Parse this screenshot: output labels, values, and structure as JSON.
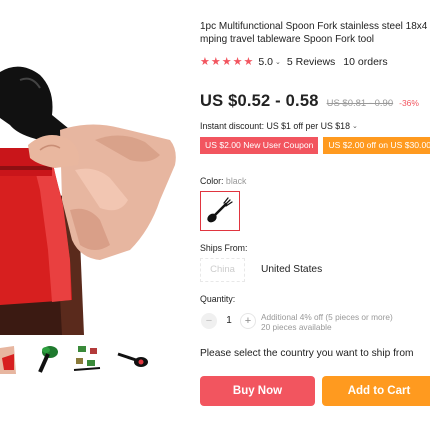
{
  "product": {
    "title_line1": "1pc Multifunctional Spoon Fork stainless steel 18x4",
    "title_line2": "mping travel tableware Spoon Fork tool"
  },
  "rating": {
    "value": "5.0",
    "stars": 5,
    "reviews": "5 Reviews",
    "orders": "10 orders"
  },
  "price": {
    "current": "US $0.52 - 0.58",
    "original": "US $0.81 - 0.90",
    "discount": "-36%"
  },
  "instant_discount": "Instant discount: US $1 off per US $18",
  "coupons": {
    "new_user": "US $2.00 New User Coupon",
    "off_30": "US $2.00 off on US $30.00"
  },
  "color": {
    "label": "Color:",
    "value": "black"
  },
  "ships_from": {
    "label": "Ships From:",
    "options": [
      "China",
      "United States"
    ]
  },
  "quantity": {
    "label": "Quantity:",
    "value": "1",
    "minus": "−",
    "plus": "+",
    "note_line1": "Additional 4% off (5 pieces or more)",
    "note_line2": "20 pieces available"
  },
  "ship_country_text": "Please select the country you want to ship from",
  "buttons": {
    "buy_now": "Buy Now",
    "add_to_cart": "Add to Cart"
  },
  "colors": {
    "accent_red": "#f2555f",
    "accent_orange": "#ff9a1f"
  }
}
